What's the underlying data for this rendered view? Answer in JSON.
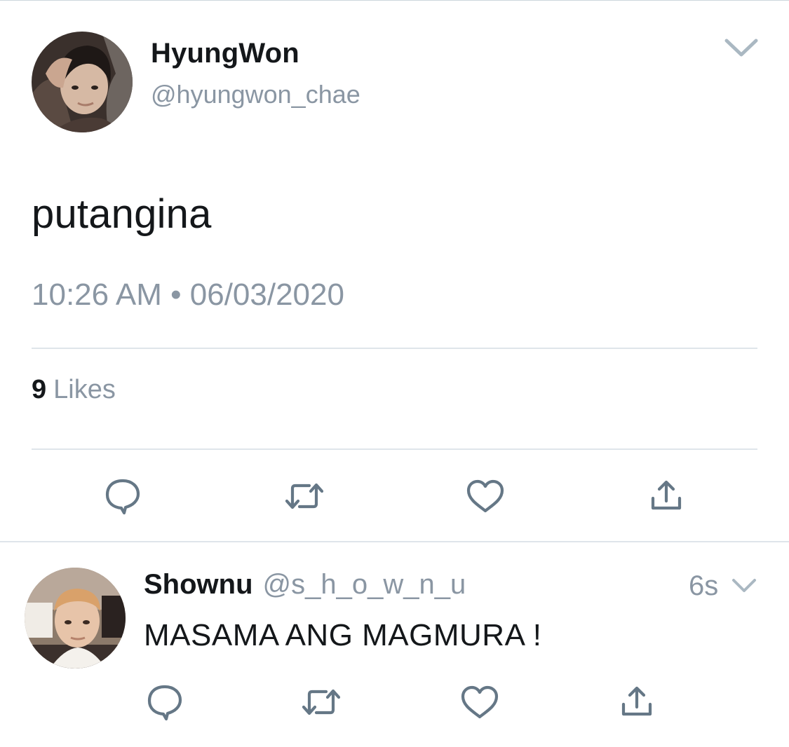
{
  "tweet": {
    "display_name": "HyungWon",
    "handle": "@hyungwon_chae",
    "text": "putangina",
    "timestamp": "10:26 AM • 06/03/2020",
    "likes_count": "9",
    "likes_label": "Likes"
  },
  "reply": {
    "display_name": "Shownu",
    "handle": "@s_h_o_w_n_u",
    "time": "6s",
    "text": "MASAMA ANG MAGMURA !"
  },
  "icons": {
    "reply": "reply-bubble-icon",
    "retweet": "retweet-icon",
    "like": "heart-icon",
    "share": "share-icon",
    "more": "chevron-down-icon"
  },
  "colors": {
    "text_primary": "#14171a",
    "text_secondary": "#8a96a3",
    "icon_gray": "#657786",
    "divider": "#dfe5ea"
  }
}
